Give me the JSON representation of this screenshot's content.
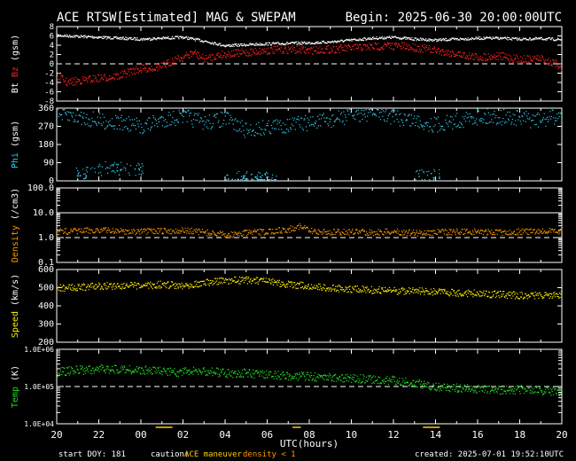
{
  "chart_data": {
    "type": "scatter",
    "title": "ACE RTSW[Estimated] MAG & SWEPAM",
    "begin": "Begin: 2025-06-30 20:00:00UTC",
    "xlabel": "UTC(hours)",
    "xticks": [
      "20",
      "22",
      "00",
      "02",
      "04",
      "06",
      "08",
      "10",
      "12",
      "14",
      "16",
      "18",
      "20"
    ],
    "xrange_hours": [
      0,
      24
    ],
    "footer": {
      "start_doy": "start DOY: 181",
      "caution_label": "caution:",
      "maneuver": "ACE maneuver",
      "density_caution": "density < 1",
      "created": "created: 2025-07-01 19:52:10UTC"
    },
    "colors": {
      "bt": "#ffffff",
      "bz": "#ff2020",
      "phi": "#33ccee",
      "density": "#ff9900",
      "speed": "#ffee00",
      "temp": "#22dd22",
      "maneuver": "#ffcc00",
      "caution": "#ff9900"
    },
    "panels": [
      {
        "id": "mag",
        "ylabel_bt": "Bt",
        "ylabel_bz": "Bz",
        "ylabel_unit": "(gsm)",
        "ylim": [
          -8,
          8
        ],
        "yticks": [
          "8",
          "6",
          "4",
          "2",
          "0",
          "-2",
          "-4",
          "-6",
          "-8"
        ],
        "dashed_zero": true,
        "bt_series": [
          [
            0,
            6.2
          ],
          [
            1,
            6.0
          ],
          [
            2,
            5.8
          ],
          [
            3,
            5.6
          ],
          [
            4,
            5.4
          ],
          [
            5,
            5.6
          ],
          [
            6,
            5.8
          ],
          [
            7,
            5.0
          ],
          [
            8,
            4.0
          ],
          [
            9,
            4.2
          ],
          [
            10,
            4.4
          ],
          [
            11,
            4.5
          ],
          [
            12,
            4.6
          ],
          [
            13,
            4.8
          ],
          [
            14,
            5.2
          ],
          [
            15,
            5.6
          ],
          [
            16,
            5.8
          ],
          [
            17,
            5.4
          ],
          [
            18,
            5.2
          ],
          [
            19,
            5.4
          ],
          [
            20,
            5.6
          ],
          [
            21,
            5.6
          ],
          [
            22,
            5.4
          ],
          [
            23,
            5.5
          ],
          [
            24,
            5.3
          ]
        ],
        "bz_series": [
          [
            0,
            -2.5
          ],
          [
            0.5,
            -4.0
          ],
          [
            1,
            -3.5
          ],
          [
            2,
            -3.0
          ],
          [
            3,
            -2.5
          ],
          [
            3.5,
            -1.5
          ],
          [
            4,
            -1.0
          ],
          [
            5,
            -0.5
          ],
          [
            5.5,
            0.8
          ],
          [
            6,
            1.5
          ],
          [
            6.5,
            2.5
          ],
          [
            7,
            1.0
          ],
          [
            7.5,
            1.8
          ],
          [
            8,
            2.2
          ],
          [
            9,
            2.5
          ],
          [
            10,
            3.0
          ],
          [
            11,
            3.2
          ],
          [
            12,
            3.0
          ],
          [
            13,
            3.2
          ],
          [
            14,
            3.5
          ],
          [
            15,
            3.8
          ],
          [
            16,
            4.0
          ],
          [
            17,
            3.6
          ],
          [
            18,
            3.0
          ],
          [
            19,
            2.2
          ],
          [
            20,
            1.5
          ],
          [
            21,
            1.8
          ],
          [
            22,
            1.0
          ],
          [
            23,
            1.2
          ],
          [
            24,
            -0.5
          ]
        ]
      },
      {
        "id": "phi",
        "ylabel": "Phi",
        "ylabel_unit": "(gsm)",
        "ylim": [
          0,
          360
        ],
        "yticks": [
          "360",
          "270",
          "180",
          "90",
          "0"
        ],
        "series": [
          [
            0,
            330
          ],
          [
            1,
            320
          ],
          [
            2,
            300
          ],
          [
            3,
            290
          ],
          [
            4,
            270
          ],
          [
            5,
            305
          ],
          [
            6,
            320
          ],
          [
            7,
            290
          ],
          [
            8,
            310
          ],
          [
            9,
            250
          ],
          [
            10,
            270
          ],
          [
            12,
            290
          ],
          [
            13,
            300
          ],
          [
            14,
            330
          ],
          [
            15,
            340
          ],
          [
            16,
            320
          ],
          [
            17,
            300
          ],
          [
            18,
            280
          ],
          [
            19,
            300
          ],
          [
            20,
            320
          ],
          [
            21,
            320
          ],
          [
            22,
            310
          ],
          [
            23,
            300
          ],
          [
            24,
            330
          ]
        ],
        "low_clusters": [
          [
            1.5,
            40
          ],
          [
            2.5,
            70
          ],
          [
            3.5,
            60
          ],
          [
            8.5,
            20
          ],
          [
            9.5,
            10
          ],
          [
            10,
            15
          ],
          [
            17.6,
            30
          ]
        ]
      },
      {
        "id": "density",
        "ylabel": "Density",
        "ylabel_unit": "(/cm3)",
        "ylim": [
          0.1,
          100
        ],
        "log": true,
        "yticks": [
          "100.0",
          "10.0",
          "1.0",
          "0.1"
        ],
        "dashed_level": 1.0,
        "solid_level": 10.0,
        "series": [
          [
            0,
            1.8
          ],
          [
            1,
            1.9
          ],
          [
            2,
            2.1
          ],
          [
            3,
            1.9
          ],
          [
            4,
            1.8
          ],
          [
            5,
            1.9
          ],
          [
            6,
            2.0
          ],
          [
            7,
            1.7
          ],
          [
            8,
            1.3
          ],
          [
            9,
            1.6
          ],
          [
            10,
            1.8
          ],
          [
            11,
            2.2
          ],
          [
            11.5,
            3.0
          ],
          [
            12,
            1.9
          ],
          [
            13,
            1.7
          ],
          [
            14,
            1.8
          ],
          [
            15,
            1.7
          ],
          [
            16,
            1.8
          ],
          [
            17,
            1.6
          ],
          [
            18,
            1.7
          ],
          [
            19,
            1.8
          ],
          [
            20,
            1.8
          ],
          [
            21,
            1.7
          ],
          [
            22,
            1.8
          ],
          [
            23,
            1.8
          ],
          [
            24,
            1.9
          ]
        ]
      },
      {
        "id": "speed",
        "ylabel": "Speed",
        "ylabel_unit": "(km/s)",
        "ylim": [
          200,
          600
        ],
        "yticks": [
          "600",
          "500",
          "400",
          "300",
          "200"
        ],
        "series": [
          [
            0,
            500
          ],
          [
            1,
            505
          ],
          [
            2,
            510
          ],
          [
            3,
            515
          ],
          [
            4,
            510
          ],
          [
            5,
            520
          ],
          [
            6,
            515
          ],
          [
            7,
            530
          ],
          [
            8,
            540
          ],
          [
            9,
            545
          ],
          [
            10,
            535
          ],
          [
            11,
            520
          ],
          [
            12,
            510
          ],
          [
            13,
            500
          ],
          [
            14,
            495
          ],
          [
            15,
            490
          ],
          [
            16,
            485
          ],
          [
            17,
            485
          ],
          [
            18,
            480
          ],
          [
            19,
            475
          ],
          [
            20,
            470
          ],
          [
            21,
            465
          ],
          [
            22,
            460
          ],
          [
            23,
            460
          ],
          [
            24,
            465
          ]
        ]
      },
      {
        "id": "temp",
        "ylabel": "Temp",
        "ylabel_unit": "(K)",
        "ylim": [
          10000,
          1000000
        ],
        "log": true,
        "yticks": [
          "1.0E+06",
          "1.0E+05",
          "1.0E+04"
        ],
        "dashed_level": 100000,
        "series": [
          [
            0,
            250000
          ],
          [
            1,
            280000
          ],
          [
            2,
            300000
          ],
          [
            3,
            300000
          ],
          [
            4,
            280000
          ],
          [
            5,
            260000
          ],
          [
            6,
            250000
          ],
          [
            7,
            270000
          ],
          [
            8,
            240000
          ],
          [
            9,
            230000
          ],
          [
            10,
            210000
          ],
          [
            11,
            200000
          ],
          [
            12,
            190000
          ],
          [
            13,
            180000
          ],
          [
            14,
            170000
          ],
          [
            15,
            160000
          ],
          [
            16,
            150000
          ],
          [
            17,
            130000
          ],
          [
            18,
            100000
          ],
          [
            19,
            95000
          ],
          [
            20,
            90000
          ],
          [
            21,
            85000
          ],
          [
            22,
            85000
          ],
          [
            23,
            80000
          ],
          [
            24,
            75000
          ]
        ]
      }
    ]
  }
}
